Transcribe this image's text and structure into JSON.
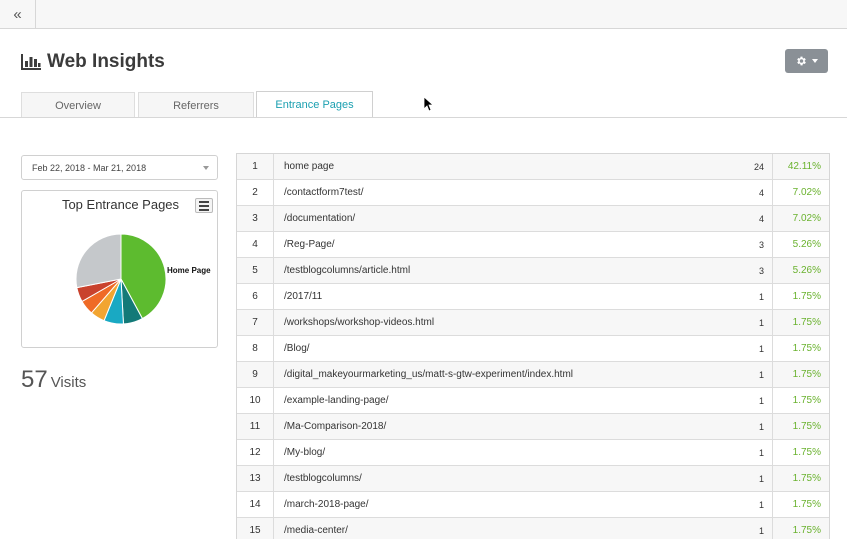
{
  "header": {
    "title": "Web Insights"
  },
  "tabs": [
    {
      "label": "Overview",
      "active": false
    },
    {
      "label": "Referrers",
      "active": false
    },
    {
      "label": "Entrance Pages",
      "active": true
    }
  ],
  "date_range": {
    "selected": "Feb 22, 2018 - Mar 21, 2018"
  },
  "chart": {
    "title": "Top Entrance Pages",
    "slice_label": "Home Page"
  },
  "chart_data": {
    "type": "pie",
    "title": "Top Entrance Pages",
    "categories": [
      "Home Page",
      "",
      "",
      "",
      "",
      "",
      ""
    ],
    "values": [
      42.11,
      7.02,
      7.02,
      5.26,
      5.26,
      5.26,
      28.07
    ],
    "colors": [
      "#5dbb2f",
      "#137a78",
      "#19a9c3",
      "#f2a531",
      "#ef6a26",
      "#c9422d",
      "#c5c8cb"
    ]
  },
  "stats": {
    "visits_count": "57",
    "visits_label": "Visits"
  },
  "table": {
    "rows": [
      {
        "rank": "1",
        "page": "home page",
        "count": "24",
        "pct": "42.11%"
      },
      {
        "rank": "2",
        "page": "/contactform7test/",
        "count": "4",
        "pct": "7.02%"
      },
      {
        "rank": "3",
        "page": "/documentation/",
        "count": "4",
        "pct": "7.02%"
      },
      {
        "rank": "4",
        "page": "/Reg-Page/",
        "count": "3",
        "pct": "5.26%"
      },
      {
        "rank": "5",
        "page": "/testblogcolumns/article.html",
        "count": "3",
        "pct": "5.26%"
      },
      {
        "rank": "6",
        "page": "/2017/11",
        "count": "1",
        "pct": "1.75%"
      },
      {
        "rank": "7",
        "page": "/workshops/workshop-videos.html",
        "count": "1",
        "pct": "1.75%"
      },
      {
        "rank": "8",
        "page": "/Blog/",
        "count": "1",
        "pct": "1.75%"
      },
      {
        "rank": "9",
        "page": "/digital_makeyourmarketing_us/matt-s-gtw-experiment/index.html",
        "count": "1",
        "pct": "1.75%"
      },
      {
        "rank": "10",
        "page": "/example-landing-page/",
        "count": "1",
        "pct": "1.75%"
      },
      {
        "rank": "11",
        "page": "/Ma-Comparison-2018/",
        "count": "1",
        "pct": "1.75%"
      },
      {
        "rank": "12",
        "page": "/My-blog/",
        "count": "1",
        "pct": "1.75%"
      },
      {
        "rank": "13",
        "page": "/testblogcolumns/",
        "count": "1",
        "pct": "1.75%"
      },
      {
        "rank": "14",
        "page": "/march-2018-page/",
        "count": "1",
        "pct": "1.75%"
      },
      {
        "rank": "15",
        "page": "/media-center/",
        "count": "1",
        "pct": "1.75%"
      }
    ]
  },
  "icons": {
    "collapse": "double-chevron-left-icon",
    "title": "bar-chart-icon",
    "settings": "gear-icon",
    "chart_menu": "hamburger-menu-icon"
  }
}
